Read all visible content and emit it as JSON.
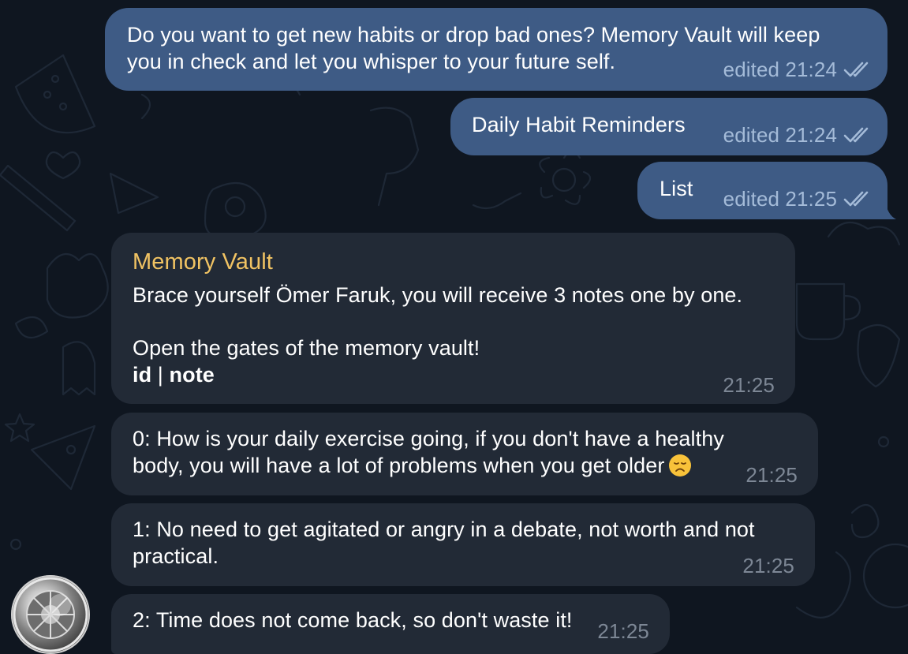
{
  "messages_out": [
    {
      "lines": [
        "Do you want to get new habits or drop bad ones? Memory Vault will keep",
        "you in check and let you whisper to your future self."
      ],
      "meta": "edited 21:24"
    },
    {
      "lines": [
        "Daily Habit Reminders"
      ],
      "meta": "edited 21:24"
    },
    {
      "lines": [
        "List"
      ],
      "meta": "edited 21:25"
    }
  ],
  "bot_message": {
    "sender": "Memory Vault",
    "line1": "Brace yourself Ömer Faruk, you will receive 3 notes one by one.",
    "line2": "Open the gates of the memory vault!",
    "header_id": "id",
    "header_sep": " | ",
    "header_note": "note",
    "time": "21:25"
  },
  "notes": [
    {
      "lines": [
        "0: How is your daily exercise going, if you don't have a healthy",
        "body, you will have a lot of problems when you get older"
      ],
      "emoji": "disappointed-face",
      "time": "21:25"
    },
    {
      "lines": [
        "1: No need to get agitated or angry in a debate, not worth and not",
        "practical."
      ],
      "time": "21:25"
    },
    {
      "lines": [
        "2: Time does not come back, so don't waste it!"
      ],
      "time": "21:25"
    }
  ],
  "avatar": {
    "icon": "vault-door-avatar"
  },
  "colors": {
    "background": "#0f1620",
    "outgoing_bubble": "#3e5b85",
    "incoming_bubble": "#222a36",
    "sender_name": "#f1c363",
    "meta_outgoing": "#a4bbd8",
    "meta_incoming": "#7d8795"
  }
}
